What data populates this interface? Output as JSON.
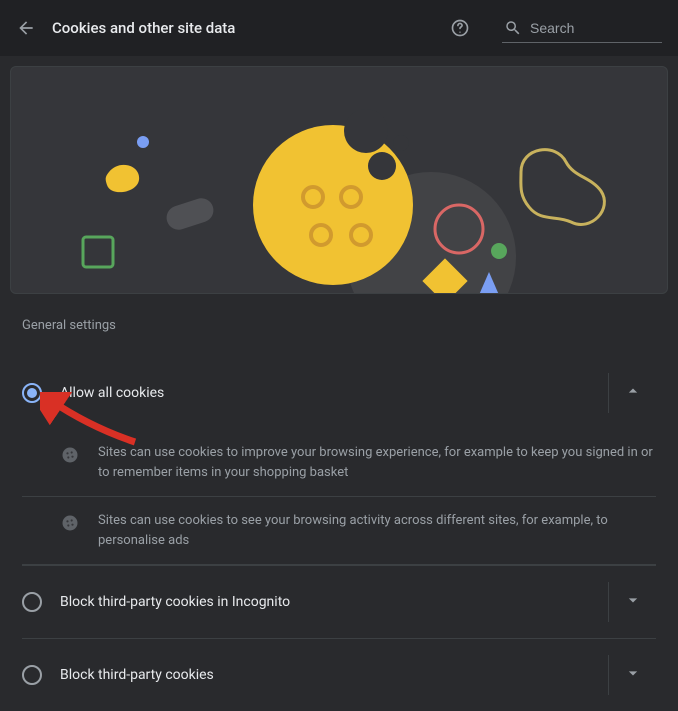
{
  "header": {
    "title": "Cookies and other site data",
    "search_placeholder": "Search"
  },
  "section_label": "General settings",
  "options": [
    {
      "label": "Allow all cookies",
      "selected": true,
      "expanded": true,
      "details": [
        "Sites can use cookies to improve your browsing experience, for example to keep you signed in or to remember items in your shopping basket",
        "Sites can use cookies to see your browsing activity across different sites, for example, to personalise ads"
      ]
    },
    {
      "label": "Block third-party cookies in Incognito",
      "selected": false,
      "expanded": false
    },
    {
      "label": "Block third-party cookies",
      "selected": false,
      "expanded": false
    }
  ]
}
